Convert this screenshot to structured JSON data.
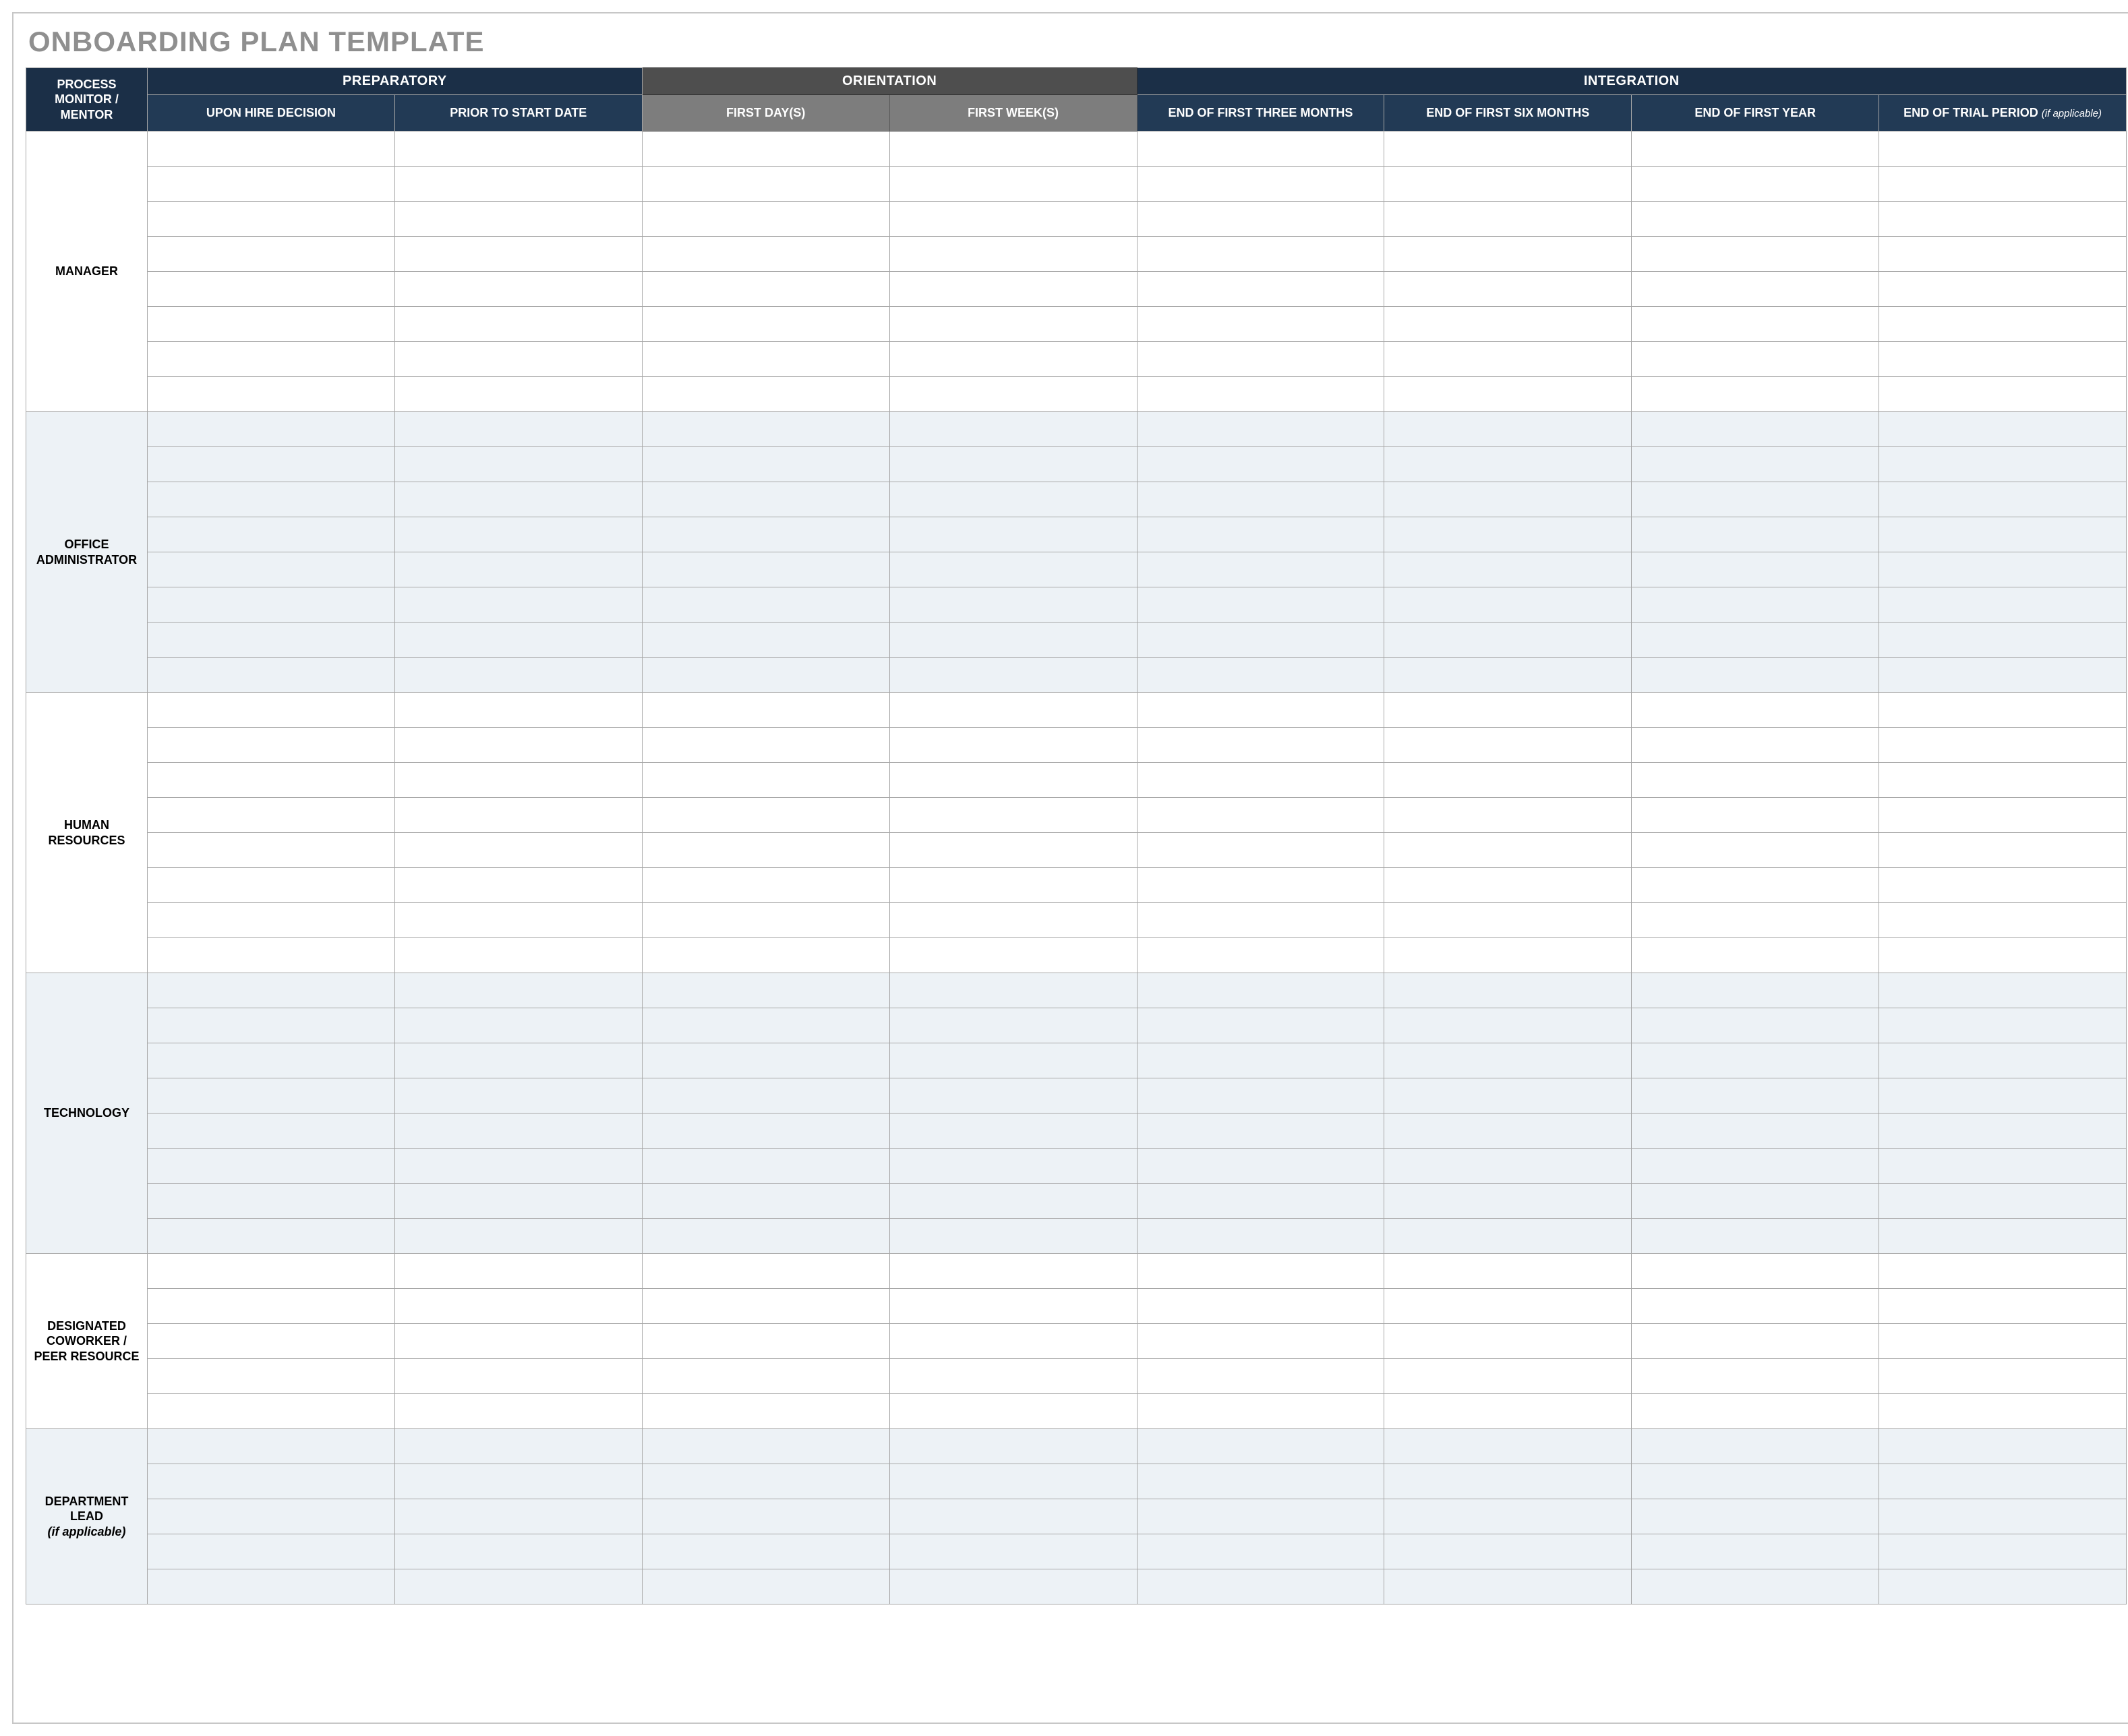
{
  "title": "ONBOARDING PLAN TEMPLATE",
  "headers": {
    "process": "PROCESS MONITOR / MENTOR",
    "groups": {
      "preparatory": "PREPARATORY",
      "orientation": "ORIENTATION",
      "integration": "INTEGRATION"
    },
    "columns": {
      "upon_hire": "UPON HIRE DECISION",
      "prior_start": "PRIOR TO START DATE",
      "first_days": "FIRST DAY(S)",
      "first_weeks": "FIRST WEEK(S)",
      "end_3m": "END OF FIRST THREE MONTHS",
      "end_6m": "END OF FIRST SIX MONTHS",
      "end_1y": "END OF FIRST YEAR",
      "end_trial": "END OF TRIAL PERIOD",
      "end_trial_note": "(if applicable)"
    }
  },
  "roles": [
    {
      "label": "MANAGER",
      "rows": 8,
      "shaded": false
    },
    {
      "label": "OFFICE ADMINISTRATOR",
      "rows": 8,
      "shaded": true
    },
    {
      "label": "HUMAN RESOURCES",
      "rows": 8,
      "shaded": false
    },
    {
      "label": "TECHNOLOGY",
      "rows": 8,
      "shaded": true
    },
    {
      "label": "DESIGNATED COWORKER / PEER RESOURCE",
      "rows": 5,
      "shaded": false
    },
    {
      "label": "DEPARTMENT LEAD",
      "label_note": "(if applicable)",
      "rows": 5,
      "shaded": true
    }
  ],
  "cells": {}
}
